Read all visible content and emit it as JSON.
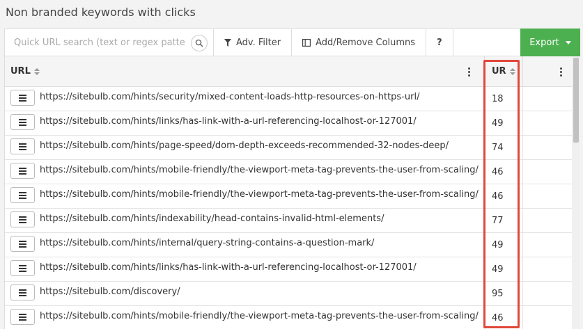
{
  "page": {
    "title": "Non branded keywords with clicks"
  },
  "toolbar": {
    "search_placeholder": "Quick URL search (text or regex pattern)",
    "adv_filter_label": "Adv. Filter",
    "columns_label": "Add/Remove Columns",
    "help_label": "?",
    "export_label": "Export",
    "export_color": "#4caf50"
  },
  "table": {
    "columns": {
      "url": "URL",
      "ur": "UR"
    },
    "highlight_color": "#e0483a",
    "rows": [
      {
        "url": "https://sitebulb.com/hints/security/mixed-content-loads-http-resources-on-https-url/",
        "ur": "18"
      },
      {
        "url": "https://sitebulb.com/hints/links/has-link-with-a-url-referencing-localhost-or-127001/",
        "ur": "49"
      },
      {
        "url": "https://sitebulb.com/hints/page-speed/dom-depth-exceeds-recommended-32-nodes-deep/",
        "ur": "74"
      },
      {
        "url": "https://sitebulb.com/hints/mobile-friendly/the-viewport-meta-tag-prevents-the-user-from-scaling/",
        "ur": "46"
      },
      {
        "url": "https://sitebulb.com/hints/mobile-friendly/the-viewport-meta-tag-prevents-the-user-from-scaling/",
        "ur": "46"
      },
      {
        "url": "https://sitebulb.com/hints/indexability/head-contains-invalid-html-elements/",
        "ur": "77"
      },
      {
        "url": "https://sitebulb.com/hints/internal/query-string-contains-a-question-mark/",
        "ur": "49"
      },
      {
        "url": "https://sitebulb.com/hints/links/has-link-with-a-url-referencing-localhost-or-127001/",
        "ur": "49"
      },
      {
        "url": "https://sitebulb.com/discovery/",
        "ur": "95"
      },
      {
        "url": "https://sitebulb.com/hints/mobile-friendly/the-viewport-meta-tag-prevents-the-user-from-scaling/",
        "ur": "46"
      }
    ]
  }
}
